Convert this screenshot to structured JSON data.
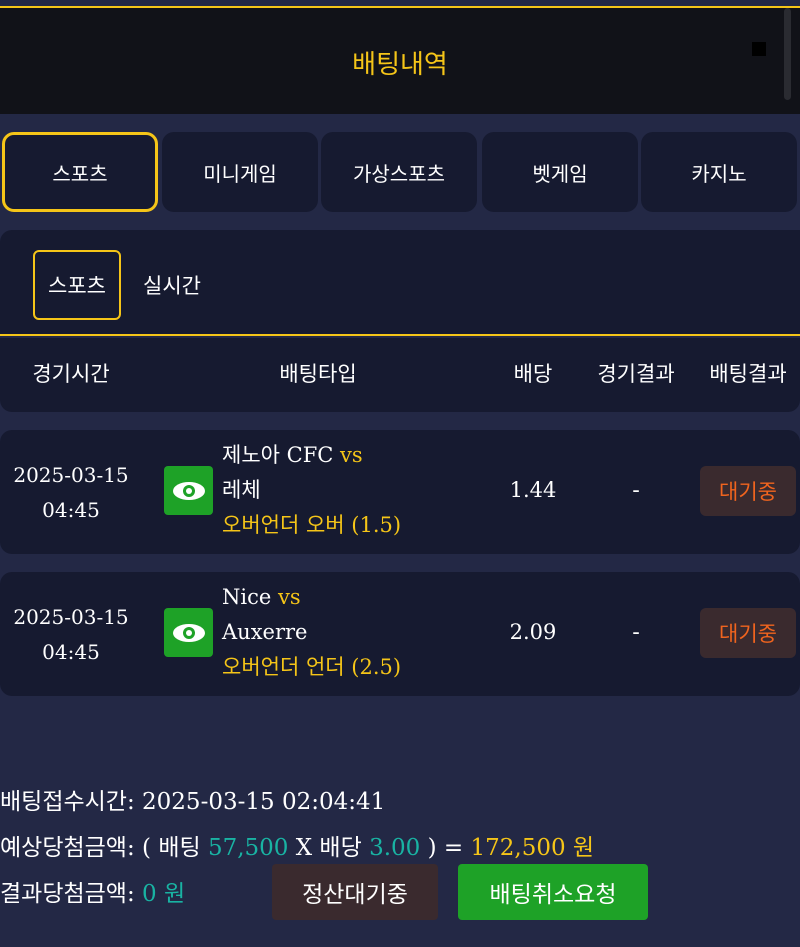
{
  "header": {
    "title": "배팅내역",
    "close_icon": "close-icon"
  },
  "tabs": [
    {
      "label": "스포츠",
      "active": true
    },
    {
      "label": "미니게임"
    },
    {
      "label": "가상스포츠"
    },
    {
      "label": "벳게임"
    },
    {
      "label": "카지노"
    }
  ],
  "subtabs": [
    {
      "label": "스포츠",
      "active": true
    },
    {
      "label": "실시간"
    }
  ],
  "table": {
    "headers": [
      "경기시간",
      "배팅타입",
      "배당",
      "경기결과",
      "배팅결과"
    ],
    "rows": [
      {
        "date": "2025-03-15",
        "time": "04:45",
        "home": "제노아 CFC",
        "vs": "vs",
        "away": "레체",
        "bet_type": "오버언더 오버 (1.5)",
        "odds": "1.44",
        "game_result": "-",
        "bet_result": "대기중"
      },
      {
        "date": "2025-03-15",
        "time": "04:45",
        "home": "Nice",
        "vs": "vs",
        "away": "Auxerre",
        "bet_type": "오버언더 언더 (2.5)",
        "odds": "2.09",
        "game_result": "-",
        "bet_result": "대기중"
      }
    ]
  },
  "summary": {
    "receipt_label": "배팅접수시간:",
    "receipt_time": "2025-03-15 02:04:41",
    "expected_label": "예상당첨금액:",
    "open_paren": "( 배팅",
    "bet_amount": "57,500",
    "times": "X 배당",
    "total_odds": "3.00",
    "close_paren": ") =",
    "expected_amount": "172,500 원",
    "result_label": "결과당첨금액:",
    "result_amount": "0 원",
    "settle_button": "정산대기중",
    "cancel_button": "배팅취소요청"
  },
  "colors": {
    "accent": "#f5c518",
    "background": "#232845",
    "panel": "#161a30",
    "teal": "#19b3a3",
    "pending": "#f0641e",
    "green_button": "#1ea227"
  }
}
